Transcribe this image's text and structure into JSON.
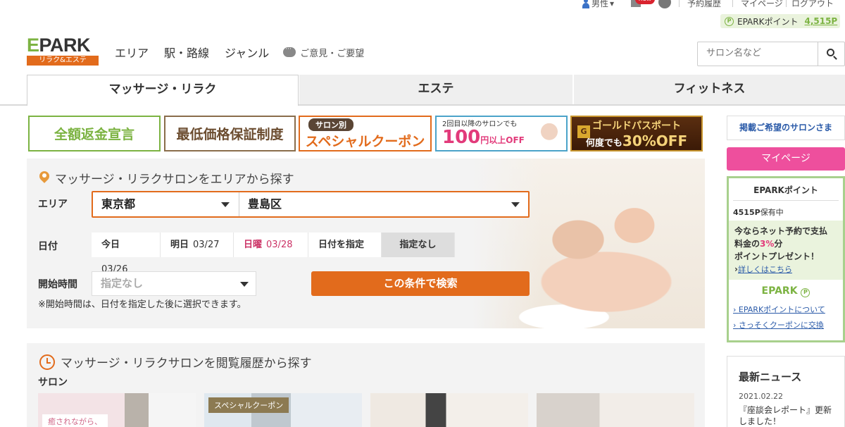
{
  "topbar": {
    "gender": "男性",
    "new_badge": "new",
    "reservation_history": "予約履歴",
    "mypage": "マイページ",
    "logout": "ログアウト",
    "points_label": "EPARKポイント",
    "points_value": "4,515P",
    "points_icon": "P"
  },
  "header": {
    "logo_word": "PARK",
    "logo_e": "E",
    "logo_sub": "リラク&エステ",
    "nav": [
      "エリア",
      "駅・路線",
      "ジャンル"
    ],
    "opinion": "ご意見・ご要望",
    "search_placeholder": "サロン名など"
  },
  "tabs": [
    "マッサージ・リラク",
    "エステ",
    "フィットネス"
  ],
  "banners": {
    "refund": "全額返金宣言",
    "lowest_price": "最低価格保証制度",
    "coupon_tag": "サロン別",
    "coupon_main": "スペシャルクーポン",
    "second_visit_l1": "2回目以降のサロンでも",
    "second_visit_amount": "100",
    "second_visit_suffix": "円以上OFF",
    "gold_l1": "ゴールドパスポート",
    "gold_l2_prefix": "何度でも",
    "gold_l2_pct": "30%OFF",
    "gold_coin": "G"
  },
  "area_search": {
    "title": "マッサージ・リラクサロンをエリアから探す",
    "area_label": "エリア",
    "prefecture": "東京都",
    "ward": "豊島区",
    "date_label": "日付",
    "dates": [
      {
        "day": "今日",
        "date": "03/26"
      },
      {
        "day": "明日",
        "date": "03/27"
      },
      {
        "day": "日曜",
        "date": "03/28"
      }
    ],
    "specify_date": "日付を指定",
    "no_date": "指定なし",
    "start_time_label": "開始時間",
    "start_time_value": "指定なし",
    "note": "※開始時間は、日付を指定した後に選択できます。",
    "search_button": "この条件で検索"
  },
  "history": {
    "title": "マッサージ・リラクサロンを閲覧履歴から探す",
    "salon_label": "サロン",
    "thumb1_caption": "癒されながら、",
    "thumb2_badge": "スペシャルクーポン"
  },
  "sidebar": {
    "listing_button": "掲載ご希望のサロンさま",
    "mypage_button": "マイページ",
    "points_header": "EPARKポイント",
    "points_held": "4515P",
    "points_held_suffix": "保有中",
    "promo_l1": "今ならネット予約で支払",
    "promo_l2_prefix": "料金の",
    "promo_pct": "3%",
    "promo_l2_suffix": "分",
    "promo_l3": "ポイントプレゼント！",
    "promo_more": "詳しくはこちら",
    "epark_logo": "EPARK",
    "link_about": "EPARKポイントについて",
    "link_exchange": "さっそくクーポンに交換",
    "news_title": "最新ニュース",
    "news_date": "2021.02.22",
    "news_text": "『座談会レポート』更新しました！"
  },
  "colors": {
    "brand_green": "#7cb342",
    "brand_orange": "#e26b1c",
    "pink": "#ee4f9d",
    "link_blue": "#2a5aa8"
  }
}
